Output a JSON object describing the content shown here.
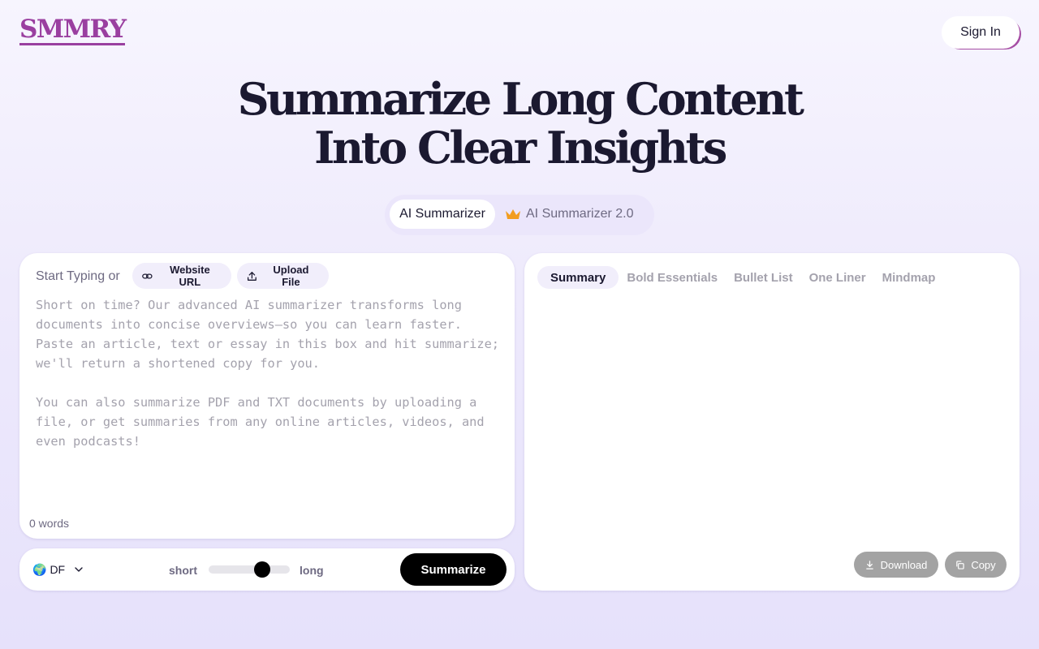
{
  "header": {
    "logo": "SMMRY",
    "sign_in_label": "Sign In"
  },
  "hero": {
    "line1": "Summarize Long Content",
    "line2_plain": "Into ",
    "line2_bold": "Clear Insights"
  },
  "mode_switch": {
    "options": [
      {
        "label": "AI Summarizer",
        "active": true
      },
      {
        "label": "AI Summarizer 2.0",
        "active": false,
        "icon": "crown-icon"
      }
    ]
  },
  "input_panel": {
    "start_label": "Start Typing or",
    "website_url_label": "Website URL",
    "upload_file_label": "Upload File",
    "placeholder": "Short on time? Our advanced AI summarizer transforms long documents into concise overviews—so you can learn faster. Paste an article, text or essay in this box and hit summarize; we'll return a shortened copy for you.\n\nYou can also summarize PDF and TXT documents by uploading a file, or get summaries from any online articles, videos, and even podcasts!",
    "value": "",
    "word_count": "0 words"
  },
  "controls": {
    "language_flag": "🌍",
    "language_code": "DF",
    "length_short_label": "short",
    "length_long_label": "long",
    "length_value": 0.66,
    "summarize_label": "Summarize"
  },
  "output_panel": {
    "tabs": [
      {
        "label": "Summary",
        "active": true
      },
      {
        "label": "Bold Essentials",
        "active": false
      },
      {
        "label": "Bullet List",
        "active": false
      },
      {
        "label": "One Liner",
        "active": false
      },
      {
        "label": "Mindmap",
        "active": false
      }
    ],
    "download_label": "Download",
    "copy_label": "Copy"
  },
  "colors": {
    "brand": "#9a3fa0",
    "crown": "#f29d1f",
    "primary_button": "#000000",
    "disabled_button": "#a3a3a3"
  }
}
